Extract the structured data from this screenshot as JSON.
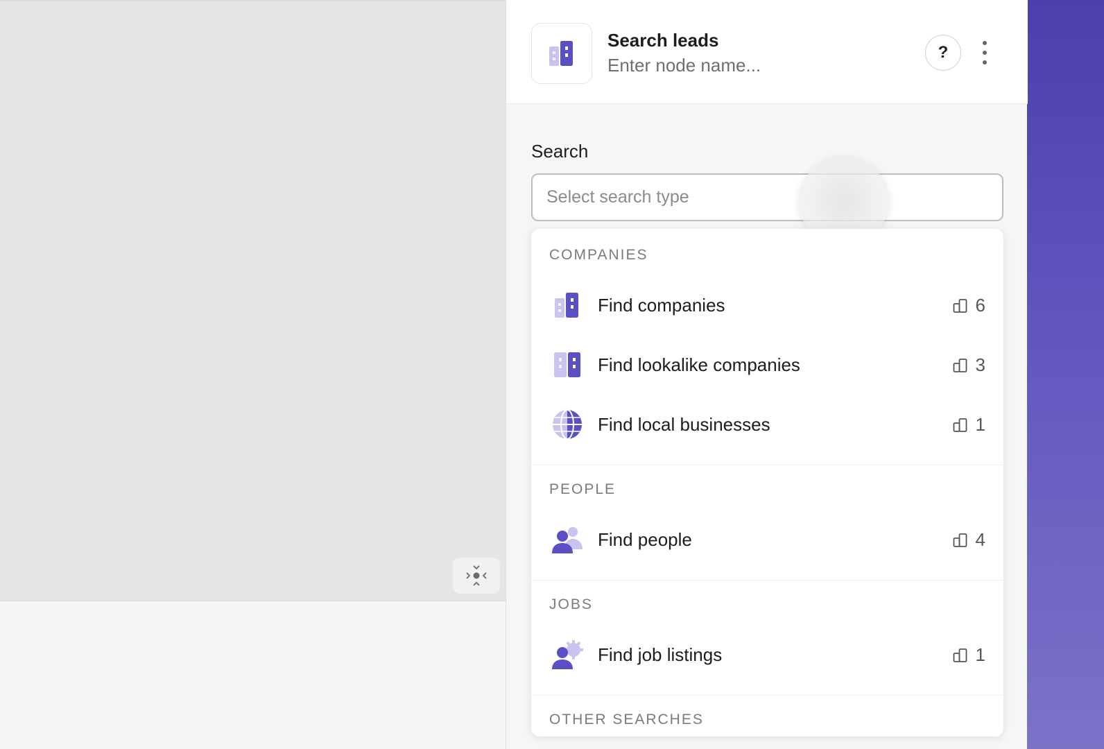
{
  "header": {
    "title": "Search leads",
    "node_name_placeholder": "Enter node name...",
    "help_label": "?"
  },
  "search": {
    "label": "Search",
    "placeholder": "Select search type"
  },
  "sections": [
    {
      "title": "COMPANIES",
      "items": [
        {
          "label": "Find companies",
          "count": "6",
          "icon": "building-icon"
        },
        {
          "label": "Find lookalike companies",
          "count": "3",
          "icon": "building-lookalike-icon"
        },
        {
          "label": "Find local businesses",
          "count": "1",
          "icon": "globe-icon"
        }
      ]
    },
    {
      "title": "PEOPLE",
      "items": [
        {
          "label": "Find people",
          "count": "4",
          "icon": "people-icon"
        }
      ]
    },
    {
      "title": "JOBS",
      "items": [
        {
          "label": "Find job listings",
          "count": "1",
          "icon": "job-person-icon"
        }
      ]
    },
    {
      "title": "OTHER SEARCHES",
      "items": []
    }
  ],
  "colors": {
    "accent": "#5b4fc4",
    "accent_light": "#c9c3f0",
    "strip": "#5a50bb"
  }
}
